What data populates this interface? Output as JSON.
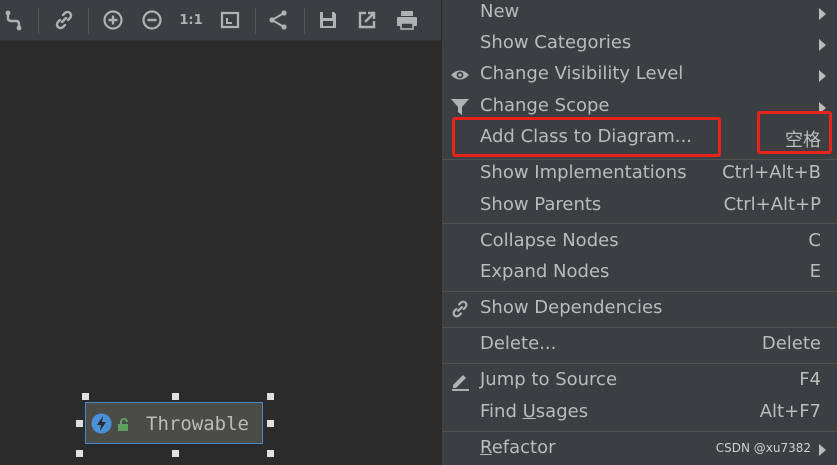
{
  "toolbar": {
    "actual_size_label": "1:1",
    "icons": [
      "route-icon",
      "link-icon",
      "zoom-in-icon",
      "zoom-out-icon",
      "actual-size-icon",
      "fit-content-icon",
      "share-icon",
      "save-icon",
      "export-icon",
      "print-icon"
    ]
  },
  "diagram": {
    "node_label": "Throwable"
  },
  "menu": {
    "items": [
      {
        "label": "New",
        "submenu": true
      },
      {
        "label": "Show Categories",
        "submenu": true
      },
      {
        "label": "Change Visibility Level",
        "submenu": true,
        "icon": "eye-icon"
      },
      {
        "label": "Change Scope",
        "submenu": true,
        "icon": "filter-icon"
      },
      {
        "label": "Add Class to Diagram...",
        "shortcut": "空格"
      },
      {
        "label": "Show Implementations",
        "shortcut": "Ctrl+Alt+B"
      },
      {
        "label": "Show Parents",
        "shortcut": "Ctrl+Alt+P"
      },
      {
        "label": "Collapse Nodes",
        "shortcut": "C"
      },
      {
        "label": "Expand Nodes",
        "shortcut": "E"
      },
      {
        "label": "Show Dependencies",
        "icon": "link-icon"
      },
      {
        "label": "Delete...",
        "shortcut": "Delete"
      },
      {
        "label": "Jump to Source",
        "shortcut": "F4",
        "icon": "edit-icon"
      },
      {
        "label_pre": "Find ",
        "label_ul": "U",
        "label_post": "sages",
        "shortcut": "Alt+F7"
      },
      {
        "label_pre": "",
        "label_ul": "R",
        "label_post": "efactor",
        "submenu": true
      }
    ]
  },
  "watermark": "CSDN @xu7382",
  "colors": {
    "highlight": "#e8231b",
    "menu_bg": "#3c3f41",
    "canvas_bg": "#2b2b2b",
    "node_border": "#4a88c7"
  }
}
